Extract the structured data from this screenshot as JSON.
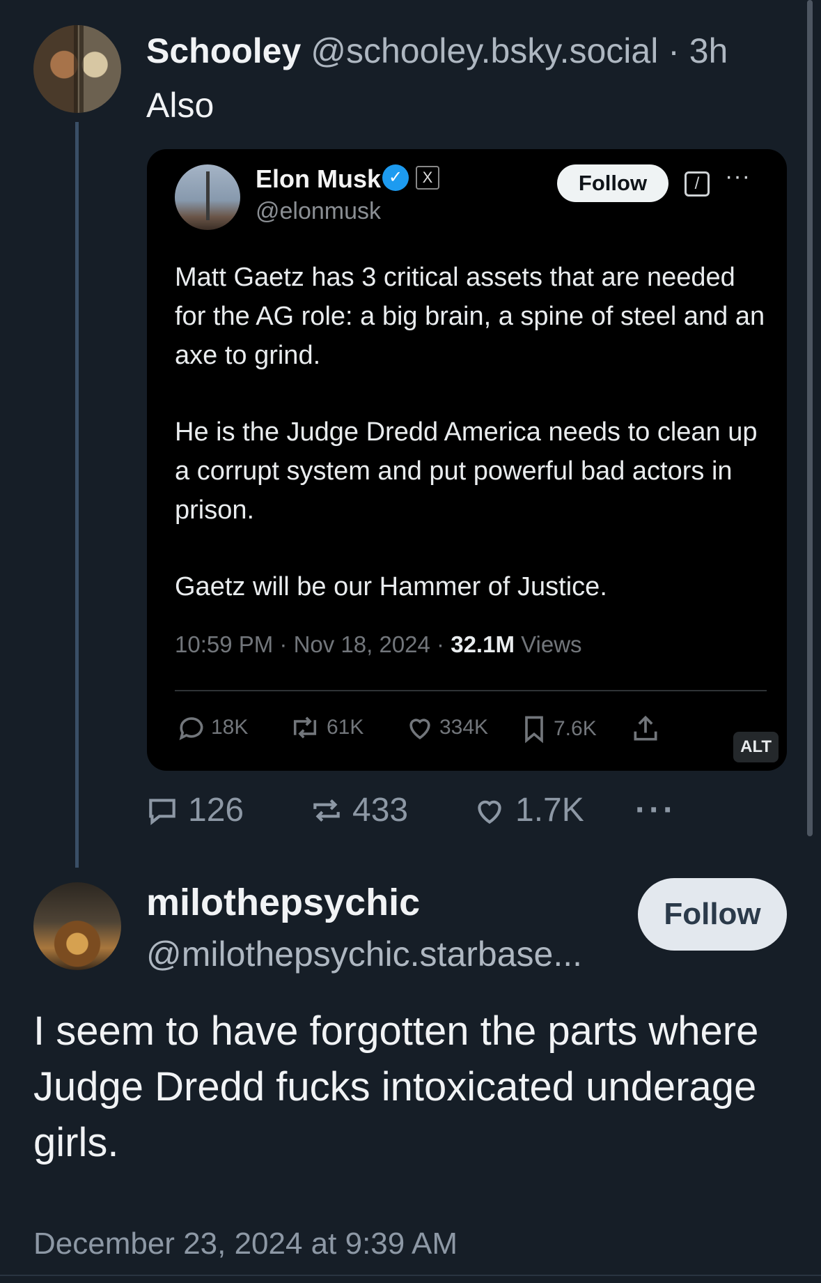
{
  "parent_post": {
    "author_name": "Schooley",
    "author_handle": "@schooley.bsky.social",
    "time_sep": " · ",
    "time": "3h",
    "text": "Also",
    "counts": {
      "replies": "126",
      "reposts": "433",
      "likes": "1.7K"
    }
  },
  "embedded_tweet": {
    "author_name": "Elon Musk",
    "author_handle": "@elonmusk",
    "follow_label": "Follow",
    "paragraphs": [
      "Matt Gaetz has 3 critical assets that are needed for the AG role: a big brain, a spine of steel and an axe to grind.",
      "He is the Judge Dredd America needs to clean up a corrupt system and put powerful bad actors in prison.",
      "Gaetz will be our Hammer of Justice."
    ],
    "meta_time": "10:59 PM · Nov 18, 2024 · ",
    "meta_views_count": "32.1M",
    "meta_views_label": " Views",
    "counts": {
      "replies": "18K",
      "reposts": "61K",
      "likes": "334K",
      "bookmarks": "7.6K"
    },
    "alt_badge": "ALT",
    "verified_color": "#1d9bf0"
  },
  "reply_post": {
    "author_name": "milothepsychic",
    "author_handle": "@milothepsychic.starbase...",
    "follow_label": "Follow",
    "text": "I seem to have forgotten the parts where Judge Dredd fucks intoxicated underage girls.",
    "date": "December 23, 2024 at 9:39 AM"
  },
  "colors": {
    "background": "#161e27",
    "thread_line": "#3a4f66",
    "muted_text": "#8d98a5"
  }
}
